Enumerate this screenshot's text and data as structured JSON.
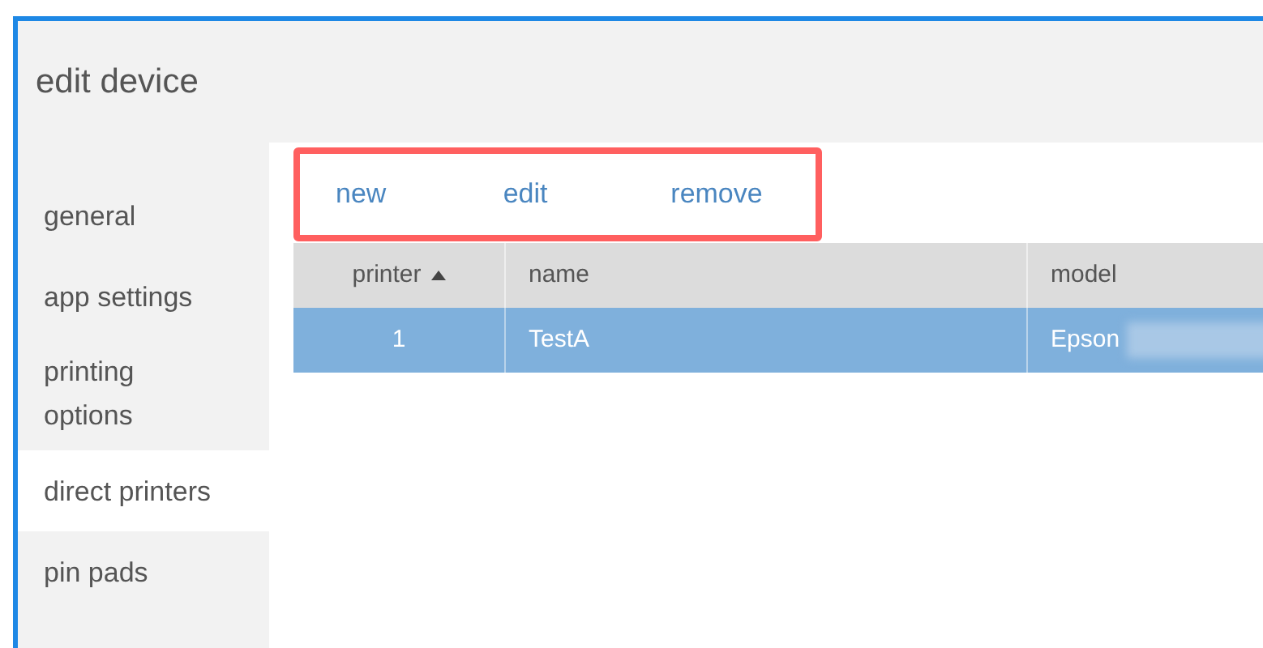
{
  "window": {
    "title": "edit device"
  },
  "sidebar": {
    "items": [
      {
        "label": "general",
        "selected": false
      },
      {
        "label": "app settings",
        "selected": false
      },
      {
        "label": "printing options",
        "selected": false
      },
      {
        "label": "direct printers",
        "selected": true
      },
      {
        "label": "pin pads",
        "selected": false
      }
    ]
  },
  "toolbar": {
    "highlighted": true,
    "actions": [
      "new",
      "edit",
      "remove"
    ]
  },
  "table": {
    "columns": [
      {
        "label": "printer",
        "sorted_ascending": true
      },
      {
        "label": "name",
        "sorted_ascending": false
      },
      {
        "label": "model",
        "sorted_ascending": false
      }
    ],
    "rows": [
      {
        "selected": true,
        "cells": [
          "1",
          "TestA",
          "Epson"
        ],
        "redacted_after_last": true
      }
    ]
  }
}
